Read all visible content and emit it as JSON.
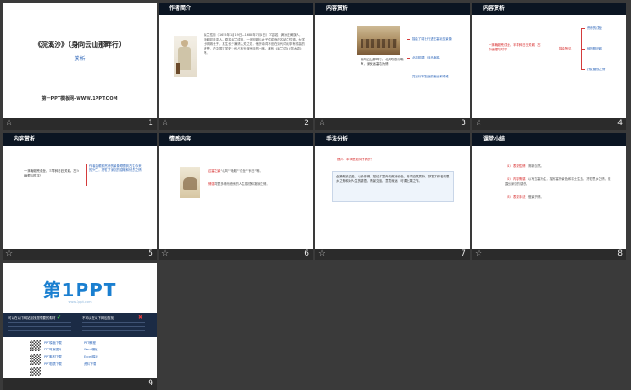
{
  "slides": [
    {
      "num": "1",
      "title": "《浣溪沙》（身向云山那畔行）",
      "subtitle": "赏析",
      "footer_text": "第一PPT模板网-WWW.1PPT.COM"
    },
    {
      "num": "2",
      "header": "作者简介",
      "body": "纳兰性德（1655年1月19日—1685年7月1日）字容若，满洲正黄旗人，清朝初年词人。原名纳兰成德，一度因避讳太子保成而改名纳兰性德。大学士明珠长子，其生长于满清入关之初，他的诗词不但在清代词坛享有很高的声誉，在中国文学史上也占有光采夺目的一席。著有《纳兰词》《饮水词》等。",
      "highlight": "《饮水词》"
    },
    {
      "num": "3",
      "header": "内容赏析",
      "caption": "身向云山那畔行，北风吹断马嘶声，深秋远塞若为情！",
      "items": [
        "描绘了将士行进在塞北的景象",
        "北风呼啸，战马嘶鸣",
        "突出行军路途的遥远和艰难"
      ]
    },
    {
      "num": "4",
      "header": "内容赏析",
      "center_text": "一抹晚烟荒戍垒，半竿斜日旧关城，古今幽恨几时平！",
      "right_label": "描绘所见",
      "items": [
        "荒凉的戍垒",
        "斜阳照旧城",
        "抒发幽恨之情"
      ]
    },
    {
      "num": "5",
      "header": "内容赏析",
      "left_text": "一抹晚烟荒戍垒，半竿斜日旧关城。古今幽恨几时平！",
      "right_text": "作者由眼前荒凉的景象联想到古往今来的兴亡，抒发了深沉的感慨和忧思之情"
    },
    {
      "num": "6",
      "header": "情感内容",
      "line1_label": "边塞之景",
      "line1": "\"北风\"\"晚烟\"\"戍垒\"\"斜日\"等。",
      "line2_label": "情感",
      "line2": "词里多情而悲凉的人生感悟和凄婉之情。"
    },
    {
      "num": "7",
      "header": "手法分析",
      "question": "提问：本词是如何抒情的？",
      "answer": "全篇情景交融，以景传情，描绘了塞外的荒凉景色，用词自然质朴，抒发了作者的思乡之情和对人生的感悟，情景交融，意境深远，可谓上乘之作。"
    },
    {
      "num": "8",
      "header": "课堂小结",
      "items": [
        {
          "label": "（1）表现性情：",
          "text": "清新自然。"
        },
        {
          "label": "（2）内容情感：",
          "text": "以写边塞为主，描写塞外景色和将士生活，抒发思乡之情，流露出深沉的感伤。"
        },
        {
          "label": "（3）表现手法：",
          "text": "借景抒情。"
        }
      ]
    },
    {
      "num": "9",
      "logo_main": "第1PPT",
      "logo_sub": "www.1ppt.com",
      "dark_left_title": "可以在以下网站查找您想要的素材",
      "dark_right_title": "不可以在以下网站查找",
      "links": [
        "PPT模板下载",
        "PPT背景图片",
        "PPT素材下载",
        "PPT图表下载",
        "PPT教程",
        "Word模板",
        "Excel模板",
        "资料下载"
      ]
    }
  ],
  "colors": {
    "header_bg": "#0b1522",
    "accent_red": "#d42020",
    "accent_blue": "#2b64b8"
  }
}
